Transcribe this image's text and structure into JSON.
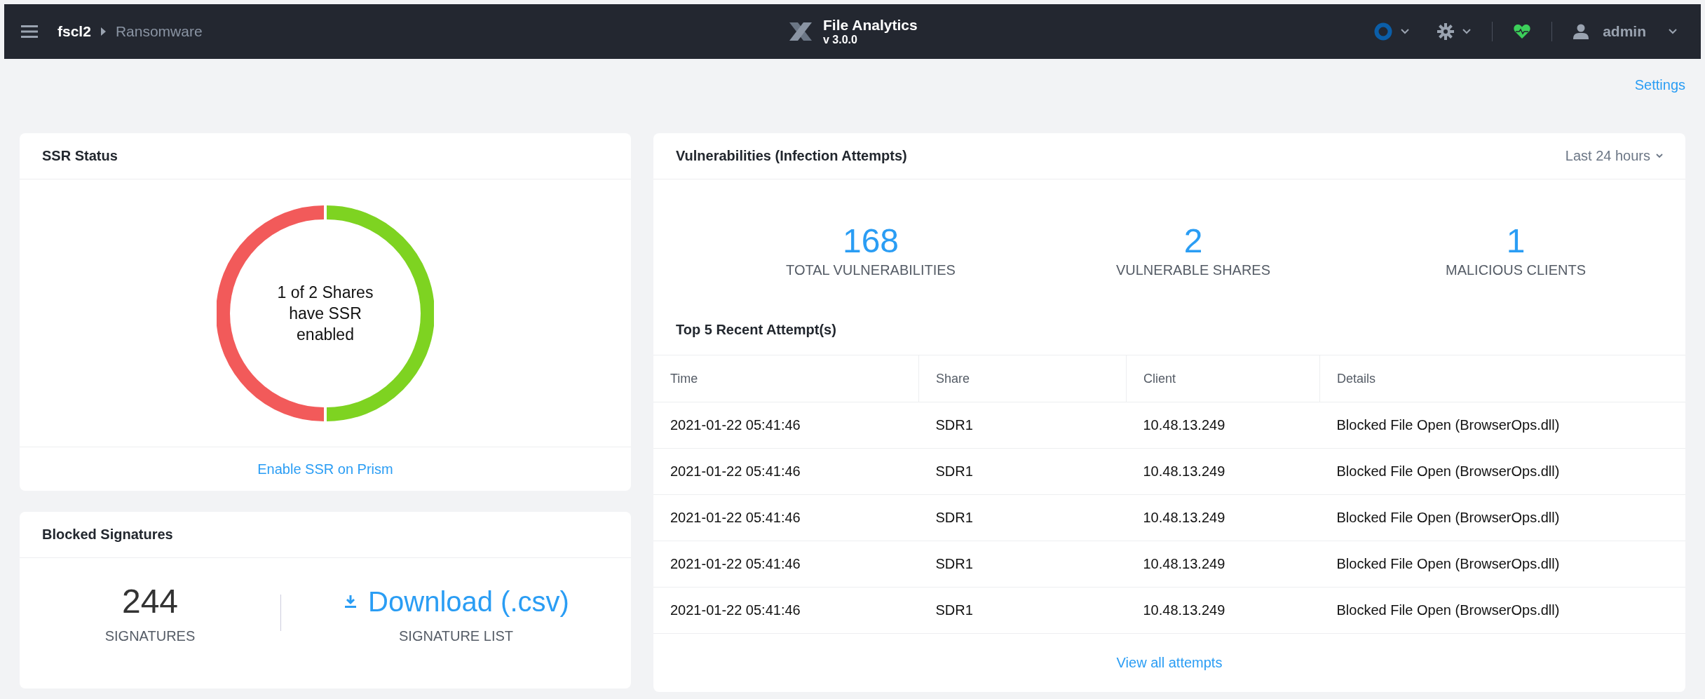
{
  "top_bar": {
    "cluster": "fscl2",
    "page": "Ransomware",
    "app_title": "File Analytics",
    "version": "v 3.0.0",
    "user": "admin"
  },
  "settings_link": "Settings",
  "ssr_status": {
    "title": "SSR Status",
    "summary": "1 of 2 Shares have SSR enabled",
    "link": "Enable SSR on Prism"
  },
  "blocked_signatures": {
    "title": "Blocked Signatures",
    "count": "244",
    "count_label": "SIGNATURES",
    "download": "Download (.csv)",
    "download_label": "SIGNATURE LIST"
  },
  "vulnerabilities": {
    "title": "Vulnerabilities (Infection Attempts)",
    "range": "Last 24 hours",
    "stats": [
      {
        "value": "168",
        "label": "TOTAL VULNERABILITIES"
      },
      {
        "value": "2",
        "label": "VULNERABLE SHARES"
      },
      {
        "value": "1",
        "label": "MALICIOUS CLIENTS"
      }
    ],
    "recent_title": "Top 5 Recent Attempt(s)",
    "table": {
      "columns": [
        "Time",
        "Share",
        "Client",
        "Details"
      ],
      "rows": [
        [
          "2021-01-22 05:41:46",
          "SDR1",
          "10.48.13.249",
          "Blocked File Open (BrowserOps.dll)"
        ],
        [
          "2021-01-22 05:41:46",
          "SDR1",
          "10.48.13.249",
          "Blocked File Open (BrowserOps.dll)"
        ],
        [
          "2021-01-22 05:41:46",
          "SDR1",
          "10.48.13.249",
          "Blocked File Open (BrowserOps.dll)"
        ],
        [
          "2021-01-22 05:41:46",
          "SDR1",
          "10.48.13.249",
          "Blocked File Open (BrowserOps.dll)"
        ],
        [
          "2021-01-22 05:41:46",
          "SDR1",
          "10.48.13.249",
          "Blocked File Open (BrowserOps.dll)"
        ]
      ]
    },
    "view_all": "View all attempts"
  }
}
